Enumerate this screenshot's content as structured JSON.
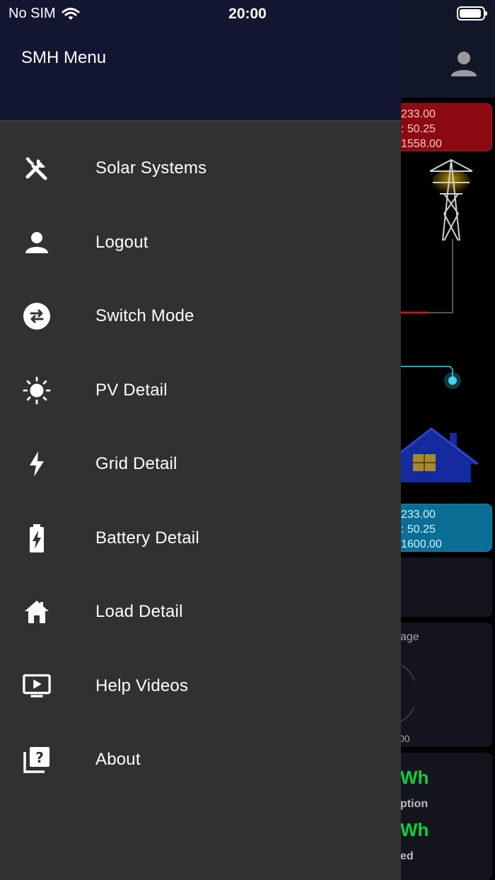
{
  "status_bar": {
    "carrier": "No SIM",
    "time": "20:00"
  },
  "drawer": {
    "title": "SMH Menu",
    "items": [
      {
        "label": "Solar Systems",
        "icon": "tools-icon"
      },
      {
        "label": "Logout",
        "icon": "person-icon"
      },
      {
        "label": "Switch Mode",
        "icon": "switch-icon"
      },
      {
        "label": "PV Detail",
        "icon": "sun-icon"
      },
      {
        "label": "Grid Detail",
        "icon": "bolt-icon"
      },
      {
        "label": "Battery Detail",
        "icon": "battery-charging-icon"
      },
      {
        "label": "Load Detail",
        "icon": "home-icon"
      },
      {
        "label": "Help Videos",
        "icon": "video-icon"
      },
      {
        "label": "About",
        "icon": "help-library-icon"
      }
    ]
  },
  "background": {
    "grid_box": {
      "line1": "233.00",
      "line2": ": 50.25",
      "line3": "1558.00"
    },
    "load_box": {
      "line1": "233.00",
      "line2": ": 50.25",
      "line3": "1600.00"
    },
    "card_label": "age",
    "card_value": "00",
    "energy_1": "Wh",
    "energy_1_label": "ption",
    "energy_2": "Wh",
    "energy_2_label": "ed"
  },
  "colors": {
    "drawer_bg": "#313131",
    "drawer_header_bg": "#131631",
    "grid_box": "#8b0a12",
    "load_box": "#0a6e95",
    "energy_green": "#0bd13a"
  }
}
